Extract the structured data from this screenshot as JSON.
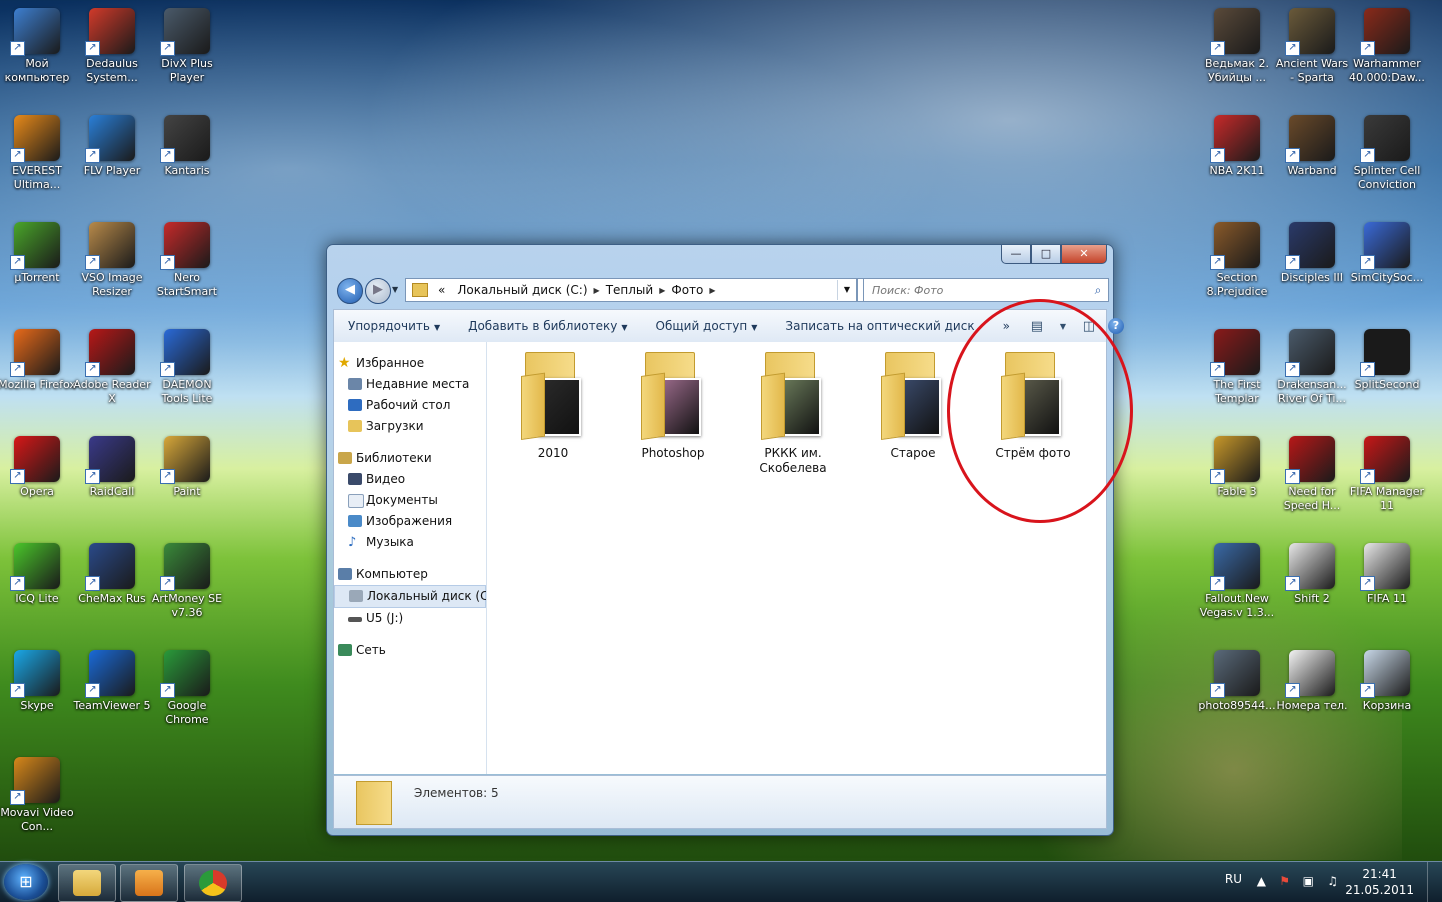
{
  "desktop_icons_left": [
    {
      "label": "Мой компьютер",
      "color": "#3d7fd1"
    },
    {
      "label": "Dedaulus System...",
      "color": "#d23a2a"
    },
    {
      "label": "DivX Plus Player",
      "color": "#4a5a6a"
    },
    {
      "label": "EVEREST Ultima...",
      "color": "#e88a1a"
    },
    {
      "label": "FLV Player",
      "color": "#2a7fd8"
    },
    {
      "label": "Kantaris",
      "color": "#444444"
    },
    {
      "label": "µTorrent",
      "color": "#4aa62a"
    },
    {
      "label": "VSO Image Resizer",
      "color": "#b88a4a"
    },
    {
      "label": "Nero StartSmart",
      "color": "#c62a2a"
    },
    {
      "label": "Mozilla Firefox",
      "color": "#e86a1a"
    },
    {
      "label": "Adobe Reader X",
      "color": "#b81818"
    },
    {
      "label": "DAEMON Tools Lite",
      "color": "#2a6ad8"
    },
    {
      "label": "Opera",
      "color": "#d81818"
    },
    {
      "label": "RaidCall",
      "color": "#3a3a8a"
    },
    {
      "label": "Paint",
      "color": "#d8a83a"
    },
    {
      "label": "ICQ Lite",
      "color": "#4ac62a"
    },
    {
      "label": "CheMax Rus",
      "color": "#2a4a8a"
    },
    {
      "label": "ArtMoney SE v7.36",
      "color": "#3a8a3a"
    },
    {
      "label": "Skype",
      "color": "#1aa8e8"
    },
    {
      "label": "TeamViewer 5",
      "color": "#1a6ad8"
    },
    {
      "label": "Google Chrome",
      "color": "#2a9a3a"
    },
    {
      "label": "Movavi Video Con...",
      "color": "#d8881a"
    }
  ],
  "desktop_icons_right": [
    {
      "label": "Ведьмак 2. Убийцы ...",
      "color": "#5a4a3a"
    },
    {
      "label": "Ancient Wars - Sparta",
      "color": "#6a5a3a"
    },
    {
      "label": "Warhammer 40.000:Daw...",
      "color": "#8a2a1a"
    },
    {
      "label": "NBA 2K11",
      "color": "#c82a2a"
    },
    {
      "label": "Warband",
      "color": "#6a4a2a"
    },
    {
      "label": "Splinter Cell Conviction",
      "color": "#3a3a3a"
    },
    {
      "label": "Section 8.Prejudice",
      "color": "#8a5a2a"
    },
    {
      "label": "Disciples III",
      "color": "#2a3a6a"
    },
    {
      "label": "SimCitySoc...",
      "color": "#3a6ad8"
    },
    {
      "label": "The First Templar",
      "color": "#8a1a1a"
    },
    {
      "label": "Drakensan... River Of Ti...",
      "color": "#4a5a6a"
    },
    {
      "label": "SplitSecond",
      "color": "#1a1a1a"
    },
    {
      "label": "Fable 3",
      "color": "#c8982a"
    },
    {
      "label": "Need for Speed H...",
      "color": "#b81818"
    },
    {
      "label": "FIFA Manager 11",
      "color": "#c81818"
    },
    {
      "label": "Fallout.New Vegas.v 1.3...",
      "color": "#3a6aa8"
    },
    {
      "label": "Shift 2",
      "color": "#e8e8e8"
    },
    {
      "label": "FIFA 11",
      "color": "#e8e8e8"
    },
    {
      "label": "photo89544...",
      "color": "#5a6a7a"
    },
    {
      "label": "Номера тел.",
      "color": "#f4f4f4"
    },
    {
      "label": "Корзина",
      "color": "#c8d8e8"
    }
  ],
  "window": {
    "min": "—",
    "max": "□",
    "close": "✕",
    "breadcrumb_prefix": "«",
    "breadcrumb": [
      "Локальный диск (C:)",
      "Теплый",
      "Фото"
    ],
    "search_placeholder": "Поиск: Фото",
    "toolbar": {
      "organize": "Упорядочить",
      "add_library": "Добавить в библиотеку",
      "share": "Общий доступ",
      "burn": "Записать на оптический диск",
      "more": "»"
    },
    "nav": {
      "favorites": "Избранное",
      "fav_items": [
        "Недавние места",
        "Рабочий стол",
        "Загрузки"
      ],
      "libraries": "Библиотеки",
      "lib_items": [
        "Видео",
        "Документы",
        "Изображения",
        "Музыка"
      ],
      "computer": "Компьютер",
      "comp_items": [
        "Локальный диск (C:)",
        "U5 (J:)"
      ],
      "network": "Сеть"
    },
    "folders": [
      {
        "name": "2010",
        "photo": "#2a2a2a"
      },
      {
        "name": "Photoshop",
        "photo": "#9a6a8a"
      },
      {
        "name": "РККК им. Скобелева",
        "photo": "#6a7a5a"
      },
      {
        "name": "Старое",
        "photo": "#3a4a6a"
      },
      {
        "name": "Стрём фото",
        "photo": "#5a5a4a"
      }
    ],
    "status": "Элементов: 5"
  },
  "taskbar": {
    "lang": "RU",
    "time": "21:41",
    "date": "21.05.2011"
  },
  "colors": {
    "accent": "#1f5cb0",
    "highlight_ring": "#d8141c"
  }
}
